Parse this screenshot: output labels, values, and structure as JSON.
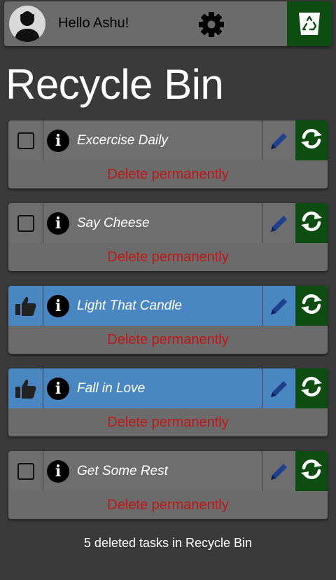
{
  "header": {
    "greeting": "Hello Ashu!",
    "avatar_icon": "user-avatar-icon",
    "settings_icon": "gear-icon",
    "bin_icon": "recycle-bin-icon"
  },
  "page": {
    "title": "Recycle Bin"
  },
  "tasks": [
    {
      "title": "Excercise Daily",
      "completed": false,
      "delete_label": "Delete permanently"
    },
    {
      "title": "Say Cheese",
      "completed": false,
      "delete_label": "Delete permanently"
    },
    {
      "title": "Light That Candle",
      "completed": true,
      "delete_label": "Delete permanently"
    },
    {
      "title": "Fall in Love",
      "completed": true,
      "delete_label": "Delete permanently"
    },
    {
      "title": "Get Some Rest",
      "completed": false,
      "delete_label": "Delete permanently"
    }
  ],
  "footer": {
    "text": "5 deleted tasks in Recycle Bin"
  },
  "colors": {
    "background": "#3a3a3a",
    "card": "#6e6e6e",
    "completed_card": "#4a86c2",
    "restore_green": "#0d4d12",
    "delete_red": "#c01818",
    "edit_blue": "#1f3f8f"
  }
}
